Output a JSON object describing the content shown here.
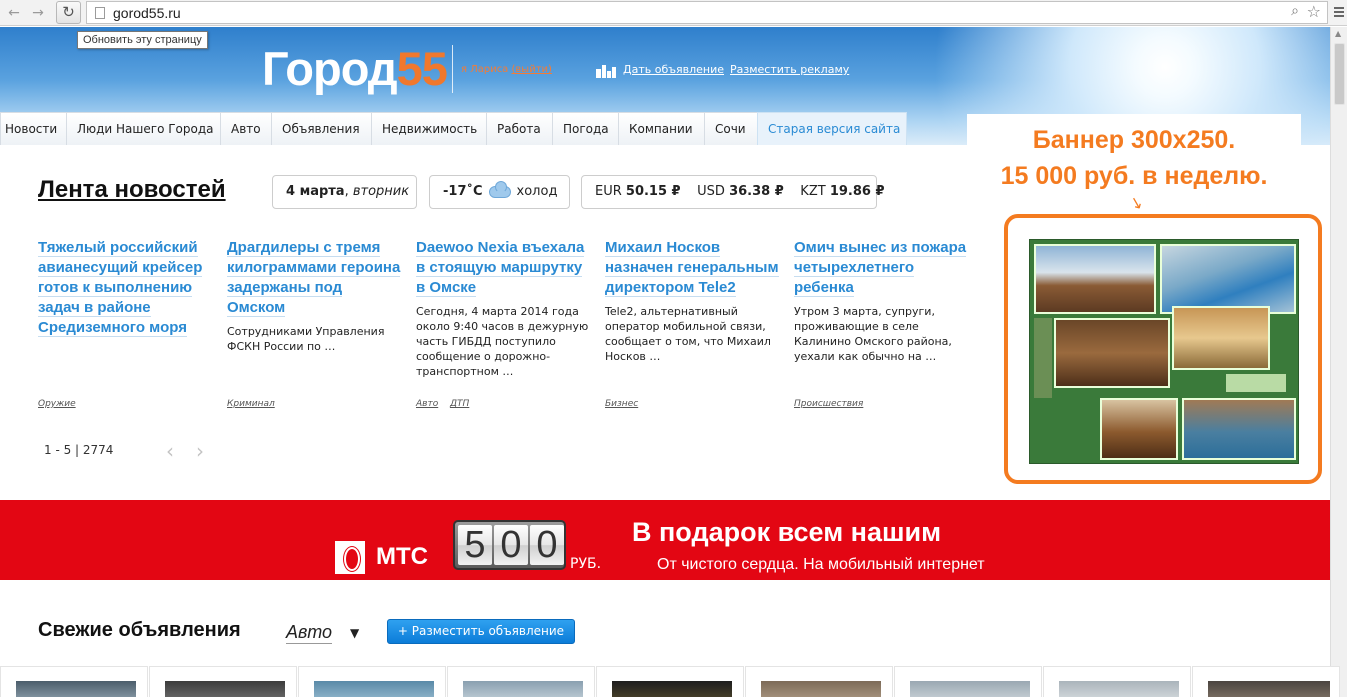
{
  "browser": {
    "url": "gorod55.ru",
    "tooltip": "Обновить эту страницу",
    "back_icon": "←",
    "forward_icon": "→",
    "reload_icon": "↻",
    "search_icon": "⌕",
    "star_icon": "☆"
  },
  "header": {
    "logo_text": "Город",
    "logo_num": "55",
    "user_name": "я Лариса",
    "logout": "(выйти)",
    "post_ad": "Дать объявление",
    "advertise": "Разместить рекламу"
  },
  "tabs": [
    "Новости",
    "Люди Нашего Города",
    "Авто",
    "Объявления",
    "Недвижимость",
    "Работа",
    "Погода",
    "Компании",
    "Сочи",
    "Старая версия сайта"
  ],
  "lenta": {
    "title": "Лента новостей",
    "date": "4 марта",
    "weekday": "вторник",
    "temp": "-17˚C",
    "weather": "холод",
    "eur_label": "EUR",
    "eur": "50.15 ₽",
    "usd_label": "USD",
    "usd": "36.38 ₽",
    "kzt_label": "KZT",
    "kzt": "19.86 ₽"
  },
  "news": [
    {
      "title": "Тяжелый российский авианесущий крейсер готов к выполнению задач в районе Средиземного моря",
      "text": "",
      "tags": [
        "Оружие"
      ]
    },
    {
      "title": "Драгдилеры с тремя килограммами героина задержаны под Омском",
      "text": "Сотрудниками Управления ФСКН России по …",
      "tags": [
        "Криминал"
      ]
    },
    {
      "title": "Daewoo Nexia въехала в стоящую маршрутку в Омске",
      "text": "Сегодня, 4 марта 2014 года около 9:40 часов в дежурную часть ГИБДД поступило сообщение о дорожно-транспортном …",
      "tags": [
        "Авто",
        "ДТП"
      ]
    },
    {
      "title": "Михаил Носков назначен генеральным директором Tele2",
      "text": "Tele2, альтернативный оператор мобильной связи, сообщает о том, что Михаил Носков …",
      "tags": [
        "Бизнес"
      ]
    },
    {
      "title": "Омич вынес из пожара четырехлетнего ребенка",
      "text": "Утром 3 марта, супруги, проживающие в селе Калинино Омского района, уехали как обычно на …",
      "tags": [
        "Происшествия"
      ]
    }
  ],
  "pager": {
    "range": "1 - 5",
    "total": "2774",
    "prev": "‹",
    "next": "›"
  },
  "ad": {
    "line1": "Баннер 300x250.",
    "line2": "15 000 руб. в неделю."
  },
  "mts": {
    "brand": "МТС",
    "digits": [
      "5",
      "0",
      "0"
    ],
    "currency": "РУБ.",
    "headline": "В подарок всем нашим",
    "subline": "От чистого сердца. На мобильный интернет"
  },
  "fresh": {
    "title": "Свежие объявления",
    "category": "Авто",
    "caret": "▼",
    "button": "+ Разместить объявление"
  },
  "colors": {
    "accent": "#2a8ad3",
    "brand_orange": "#f47b20",
    "mts_red": "#e30613"
  }
}
